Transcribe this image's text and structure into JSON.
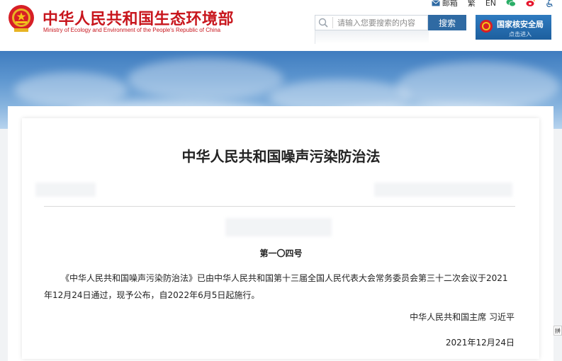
{
  "header": {
    "site_title": "中华人民共和国生态环境部",
    "site_subtitle": "Ministry of Ecology and Environment of the People's Republic of China",
    "links": {
      "mail": "邮箱",
      "traditional": "繁",
      "english": "EN"
    },
    "search": {
      "placeholder": "请输入您要搜索的内容",
      "button_label": "搜索"
    },
    "nsa_banner": {
      "title": "国家核安全局",
      "enter": "点击进入"
    }
  },
  "article": {
    "title": "中华人民共和国噪声污染防治法",
    "doc_number": "第一〇四号",
    "body": "《中华人民共和国噪声污染防治法》已由中华人民共和国第十三届全国人民代表大会常务委员会第三十二次会议于2021年12月24日通过，现予公布，自2022年6月5日起施行。",
    "signature": "中华人民共和国主席  习近平",
    "date": "2021年12月24日"
  },
  "side_tab": "拼",
  "colors": {
    "brand_red": "#c8161d",
    "search_button": "#2f6aa3",
    "nsa_blue": "#1d5f9e"
  },
  "icons": [
    "national-emblem-icon",
    "mail-icon",
    "wechat-icon",
    "weibo-icon",
    "accessibility-icon",
    "search-icon"
  ]
}
